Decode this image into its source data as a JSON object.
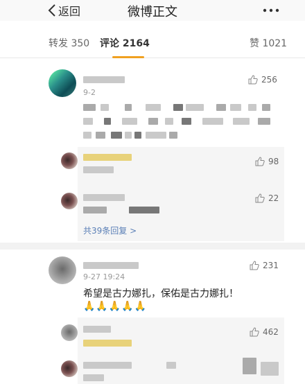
{
  "nav": {
    "back_label": "返回",
    "title": "微博正文"
  },
  "tabs": {
    "repost": "转发 350",
    "comments": "评论 2164",
    "likes": "赞 1021"
  },
  "comments": [
    {
      "date": "9-2",
      "likes": "256",
      "replies": [
        {
          "likes": "98"
        },
        {
          "likes": "22"
        }
      ],
      "more_replies": "共39条回复 >"
    },
    {
      "date": "9-27 19:24",
      "likes": "231",
      "text": "希望是古力娜扎，保佑是古力娜扎！",
      "emoji": "🙏🙏🙏🙏🙏",
      "replies": [
        {
          "likes": "462"
        }
      ]
    }
  ],
  "colors": {
    "accent": "#f0a020",
    "link": "#5a7fb6"
  }
}
